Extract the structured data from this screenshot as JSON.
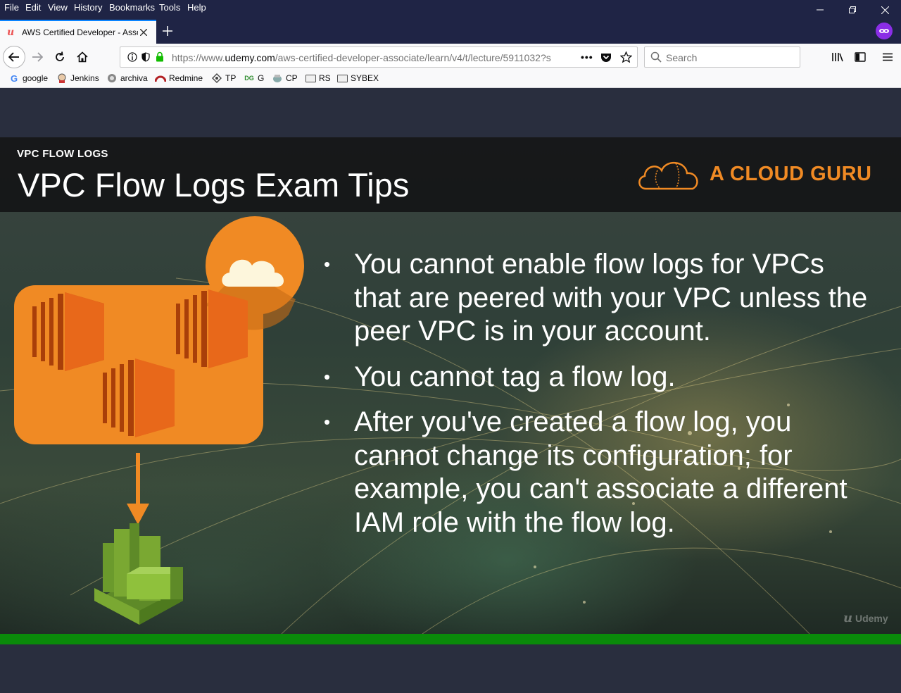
{
  "menubar": {
    "items": [
      {
        "label": "File"
      },
      {
        "label": "Edit"
      },
      {
        "label": "View"
      },
      {
        "label": "History"
      },
      {
        "label": "Bookmarks"
      },
      {
        "label": "Tools"
      },
      {
        "label": "Help"
      }
    ]
  },
  "tab": {
    "title": "AWS Certified Developer - Asso",
    "favicon": "udemy-icon"
  },
  "navbar": {
    "url_prefix": "https://www.",
    "url_domain": "udemy.com",
    "url_path": "/aws-certified-developer-associate/learn/v4/t/lecture/5911032?s",
    "search_placeholder": "Search"
  },
  "bookmarks": [
    {
      "label": "google",
      "icon": "google-icon"
    },
    {
      "label": "Jenkins",
      "icon": "jenkins-icon"
    },
    {
      "label": "archiva",
      "icon": "archiva-icon"
    },
    {
      "label": "Redmine",
      "icon": "redmine-icon"
    },
    {
      "label": "TP",
      "icon": "tp-icon"
    },
    {
      "label": "G",
      "icon": "g-icon"
    },
    {
      "label": "CP",
      "icon": "cp-icon"
    },
    {
      "label": "RS",
      "icon": "folder-icon"
    },
    {
      "label": "SYBEX",
      "icon": "folder-icon"
    }
  ],
  "slide": {
    "kicker": "VPC FLOW LOGS",
    "title": "VPC Flow Logs Exam Tips",
    "brand": "A CLOUD GURU",
    "bullets": [
      "You cannot enable flow logs for VPCs that are peered with your VPC unless the peer VPC is in your account.",
      "You cannot tag a flow log.",
      "After you've created a flow log, you cannot change its configuration; for example, you can't associate a different IAM role with the flow log."
    ],
    "watermark": "Udemy"
  },
  "colors": {
    "accent_orange": "#f08a24",
    "progress_green": "#0a8a0a",
    "chrome_dark": "#1f2445"
  }
}
